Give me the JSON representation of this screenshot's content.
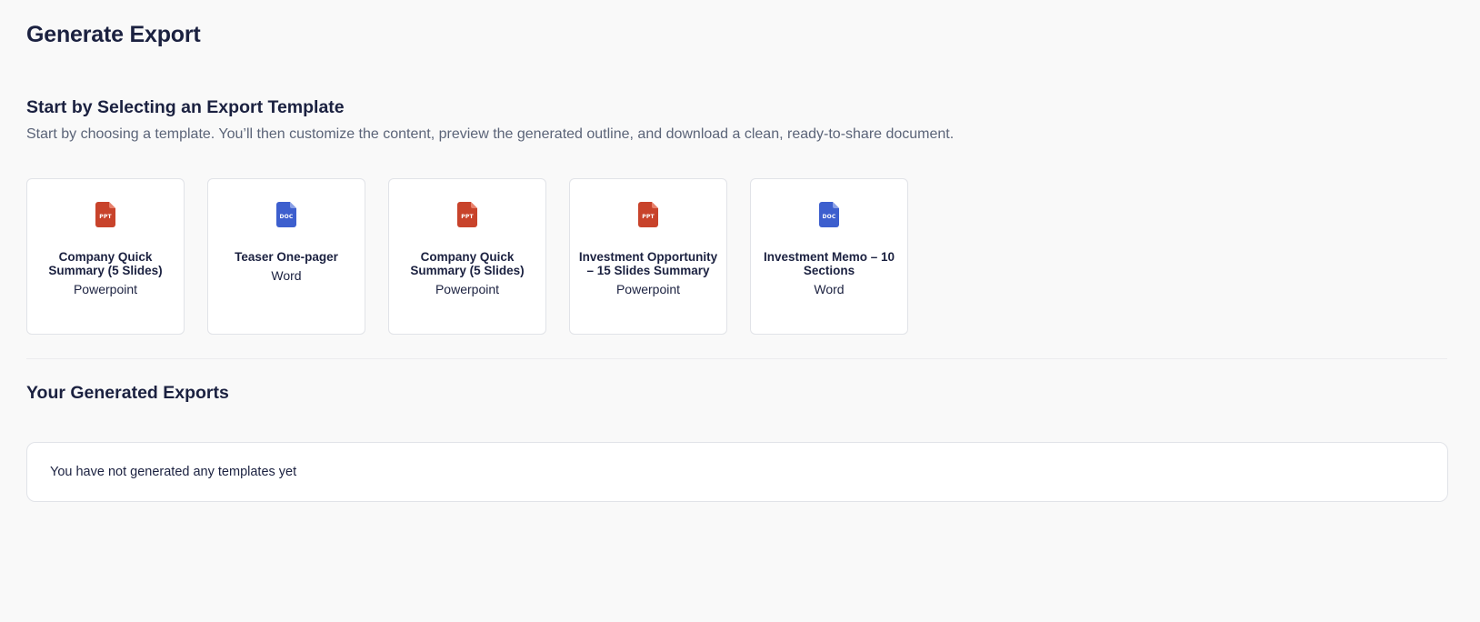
{
  "page": {
    "title": "Generate Export"
  },
  "templates_section": {
    "heading": "Start by Selecting an Export Template",
    "description": "Start by choosing a template. You’ll then customize the content, preview the generated outline, and download a clean, ready-to-share document.",
    "templates": [
      {
        "icon": "ppt-file-icon",
        "icon_tag": "PPT",
        "icon_color": "#c8432b",
        "title": "Company Quick Summary (5 Slides)",
        "type": "Powerpoint"
      },
      {
        "icon": "doc-file-icon",
        "icon_tag": "DOC",
        "icon_color": "#3d5fce",
        "title": "Teaser One-pager",
        "type": "Word"
      },
      {
        "icon": "ppt-file-icon",
        "icon_tag": "PPT",
        "icon_color": "#c8432b",
        "title": "Company Quick Summary (5 Slides)",
        "type": "Powerpoint"
      },
      {
        "icon": "ppt-file-icon",
        "icon_tag": "PPT",
        "icon_color": "#c8432b",
        "title": "Investment Opportunity – 15 Slides Summary",
        "type": "Powerpoint"
      },
      {
        "icon": "doc-file-icon",
        "icon_tag": "DOC",
        "icon_color": "#3d5fce",
        "title": "Investment Memo – 10 Sections",
        "type": "Word"
      }
    ]
  },
  "exports_section": {
    "heading": "Your Generated Exports",
    "empty_message": "You have not generated any templates yet"
  },
  "colors": {
    "background": "#f9f9f9",
    "text_primary": "#1b2140",
    "text_secondary": "#5b6478",
    "card_border": "#e1e3e8",
    "ppt_accent": "#c8432b",
    "doc_accent": "#3d5fce"
  }
}
